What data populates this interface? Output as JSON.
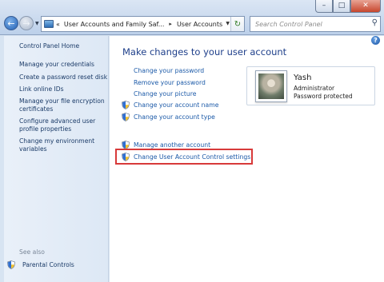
{
  "window": {
    "minimize_glyph": "–",
    "maximize_glyph": "□",
    "close_glyph": "✕"
  },
  "nav": {
    "back_glyph": "←",
    "forward_glyph": "→",
    "dropdown_glyph": "▼"
  },
  "address": {
    "overflow": "«",
    "crumbs": [
      "User Accounts and Family Saf...",
      "User Accounts"
    ],
    "separator": "▸",
    "refresh_glyph": "↻"
  },
  "search": {
    "placeholder": "Search Control Panel",
    "icon": "search-icon",
    "glyph": "⚲"
  },
  "sidebar": {
    "home": "Control Panel Home",
    "links": [
      "Manage your credentials",
      "Create a password reset disk",
      "Link online IDs",
      "Manage your file encryption certificates",
      "Configure advanced user profile properties",
      "Change my environment variables"
    ],
    "see_also": "See also",
    "parental_controls": "Parental Controls"
  },
  "main": {
    "help_glyph": "?",
    "heading": "Make changes to your user account",
    "tasks": [
      {
        "label": "Change your password",
        "shield": false
      },
      {
        "label": "Remove your password",
        "shield": false
      },
      {
        "label": "Change your picture",
        "shield": false
      },
      {
        "label": "Change your account name",
        "shield": true
      },
      {
        "label": "Change your account type",
        "shield": true
      }
    ],
    "other_tasks": [
      {
        "label": "Manage another account",
        "shield": true
      },
      {
        "label": "Change User Account Control settings",
        "shield": true
      }
    ],
    "highlight_color": "#d83a3a"
  },
  "user": {
    "name": "Yash",
    "role": "Administrator",
    "status": "Password protected"
  },
  "colors": {
    "link": "#1c5aa8",
    "heading": "#1e3f8a",
    "sidebar_link": "#1a3a67"
  }
}
